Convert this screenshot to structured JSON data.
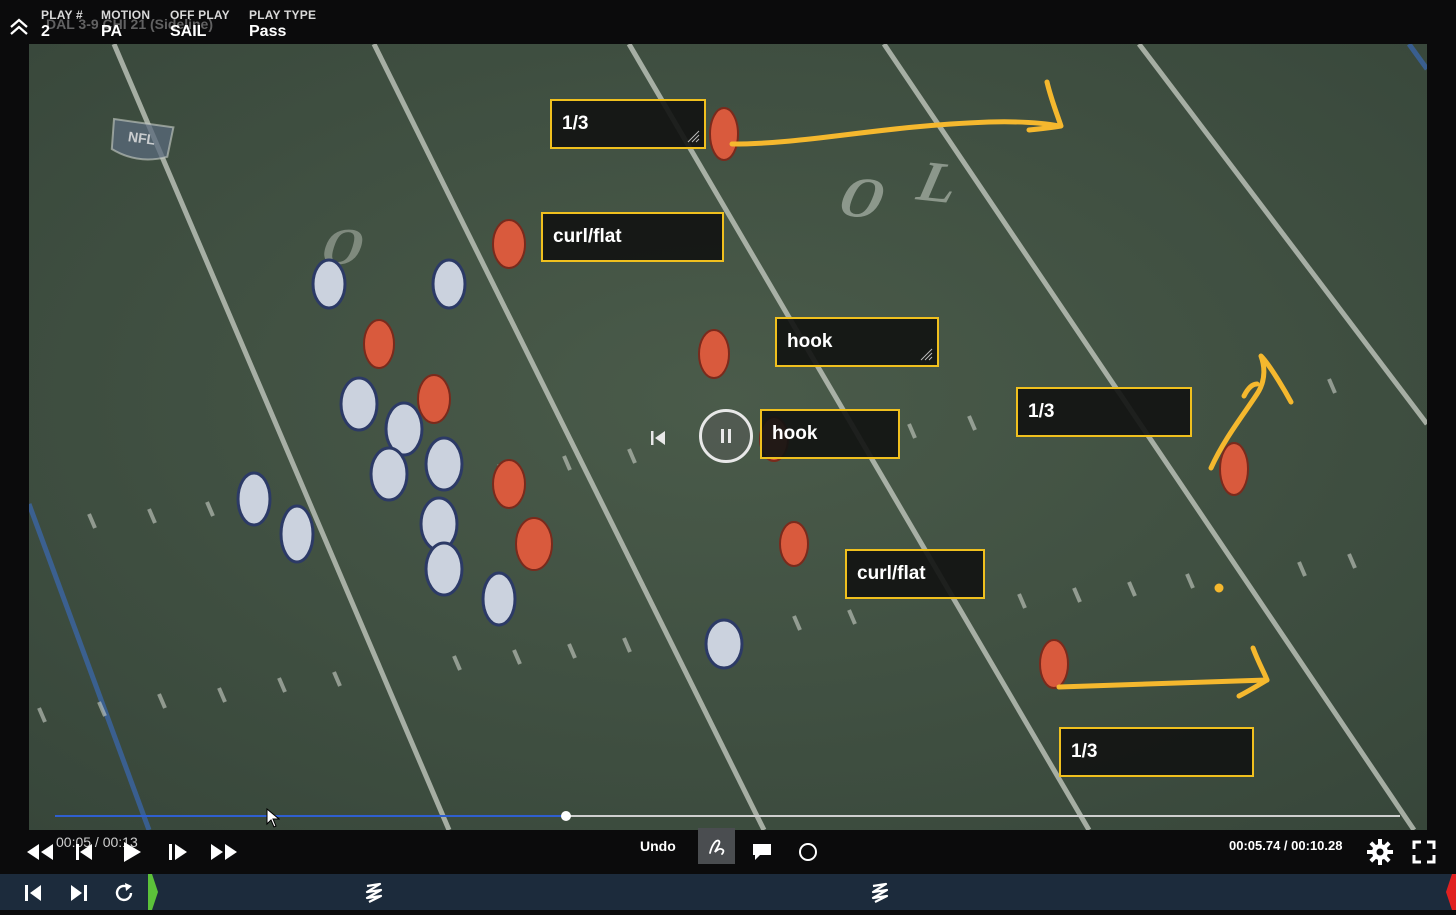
{
  "header": {
    "fields": [
      {
        "label": "PLAY #",
        "value": "2"
      },
      {
        "label": "MOTION",
        "value": "PA"
      },
      {
        "label": "OFF PLAY",
        "value": "SAIL"
      },
      {
        "label": "PLAY TYPE",
        "value": "Pass"
      }
    ],
    "ghost_text": "DAL 3-9 CHI 21 (Sideline)"
  },
  "annotations": [
    {
      "text": "1/3"
    },
    {
      "text": "curl/flat"
    },
    {
      "text": "hook"
    },
    {
      "text": "hook"
    },
    {
      "text": "1/3"
    },
    {
      "text": "curl/flat"
    },
    {
      "text": "1/3"
    }
  ],
  "playback": {
    "time_left": "00:05 / 00:13",
    "time_right": "00:05.74 / 00:10.28",
    "progress": 0.38,
    "undo_label": "Undo"
  },
  "field_marks": {
    "yard_numbers": [
      "O",
      "OL",
      "NFL"
    ]
  },
  "colors": {
    "annotation_border": "#f0c01e",
    "drawing_stroke": "#f5b82e",
    "progress": "#2f5fd0",
    "bottom_bar": "#1c2b3c",
    "marker_green": "#5cc13a",
    "marker_red": "#e02020"
  },
  "icons": {
    "collapse": "chevron-up-double-icon",
    "skip_back": "rewind-icon",
    "step_back": "step-back-icon",
    "play": "play-icon",
    "step_forward": "step-forward-icon",
    "skip_forward": "fast-forward-icon",
    "draw": "pen-draw-icon",
    "comment": "comment-icon",
    "circle": "circle-tool-icon",
    "settings": "gear-icon",
    "fullscreen": "fullscreen-icon"
  }
}
